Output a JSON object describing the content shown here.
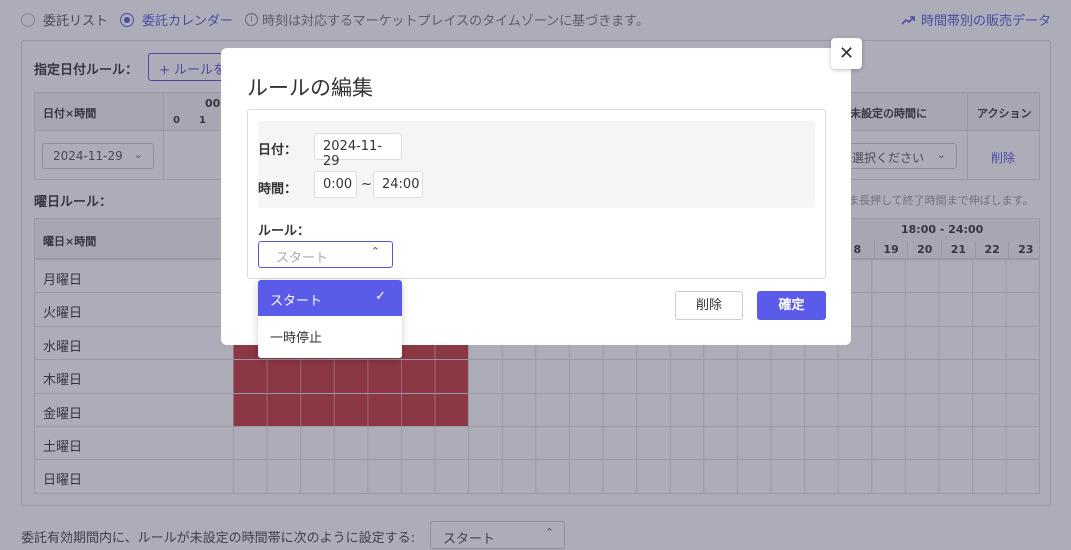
{
  "topbar": {
    "view_list": "委託リスト",
    "view_calendar": "委託カレンダー",
    "timezone_note": "時刻は対応するマーケットプレイスのタイムゾーンに基づきます。",
    "sales_link": "時間帯別の販売データ"
  },
  "date_rules": {
    "label": "指定日付ルール：",
    "add_button": "+ ルールを",
    "col_date_time": "日付×時間",
    "col_hour_group": "00:",
    "col_h0": "0",
    "col_h1": "1",
    "col_unset": "未設定の時間に",
    "col_action": "アクション",
    "row_date": "2024-11-29",
    "row_unset_select": "選択ください",
    "row_delete": "削除"
  },
  "weekday_rules": {
    "label": "曜日ルール：",
    "hold_note": "ま長押して終了時間まで伸ばします。",
    "col_day_time": "曜日×時間",
    "range_label": "18:00 - 24:00",
    "hours": [
      "8",
      "19",
      "20",
      "21",
      "22",
      "23"
    ],
    "days": [
      "月曜日",
      "火曜日",
      "水曜日",
      "木曜日",
      "金曜日",
      "土曜日",
      "日曜日"
    ]
  },
  "footer": {
    "text": "委託有効期間内に、ルールが未設定の時間帯に次のように設定する:",
    "select_value": "スタート"
  },
  "modal": {
    "title": "ルールの編集",
    "date_label": "日付：",
    "date_value": "2024-11-29",
    "time_label": "時間：",
    "time_start": "0:00",
    "time_sep": "~",
    "time_end": "24:00",
    "rule_label": "ルール：",
    "rule_placeholder": "スタート",
    "delete_button": "削除",
    "confirm_button": "確定",
    "close_icon": "close-icon"
  },
  "dropdown": {
    "options": [
      "スタート",
      "一時停止"
    ],
    "selected": "スタート"
  },
  "colors": {
    "accent": "#5b5bea",
    "active_block": "#c73434"
  }
}
